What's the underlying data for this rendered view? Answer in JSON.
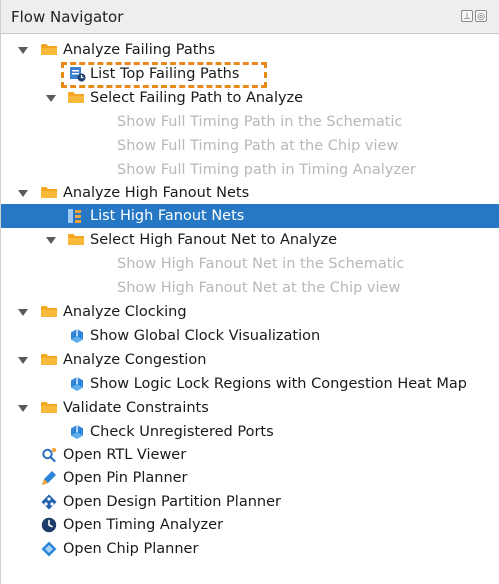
{
  "panel": {
    "title": "Flow Navigator",
    "toolbar_icons": [
      "pin-icon",
      "float-icon"
    ]
  },
  "tree": {
    "analyze_failing_paths": "Analyze Failing Paths",
    "list_top_failing_paths": "List Top Failing Paths",
    "select_failing_path": "Select Failing Path to Analyze",
    "show_full_timing_schematic": "Show Full Timing Path in the Schematic",
    "show_full_timing_chip": "Show Full Timing Path at the Chip view",
    "show_full_timing_analyzer": "Show Full Timing path in Timing Analyzer",
    "analyze_high_fanout": "Analyze High Fanout Nets",
    "list_high_fanout": "List High Fanout Nets",
    "select_high_fanout": "Select High Fanout Net to Analyze",
    "show_fanout_schematic": "Show High Fanout Net in the Schematic",
    "show_fanout_chip": "Show High Fanout Net at the Chip view",
    "analyze_clocking": "Analyze Clocking",
    "show_global_clock": "Show Global Clock Visualization",
    "analyze_congestion": "Analyze Congestion",
    "show_logic_lock": "Show Logic Lock Regions with Congestion Heat Map",
    "validate_constraints": "Validate Constraints",
    "check_unregistered": "Check Unregistered Ports",
    "open_rtl_viewer": "Open RTL Viewer",
    "open_pin_planner": "Open Pin Planner",
    "open_design_partition": "Open Design Partition Planner",
    "open_timing_analyzer": "Open Timing Analyzer",
    "open_chip_planner": "Open Chip Planner"
  },
  "colors": {
    "selection": "#2677c4",
    "folder": "#f5a623",
    "highlight": "#e88a1a",
    "disabled_text": "#b8b8b8"
  }
}
